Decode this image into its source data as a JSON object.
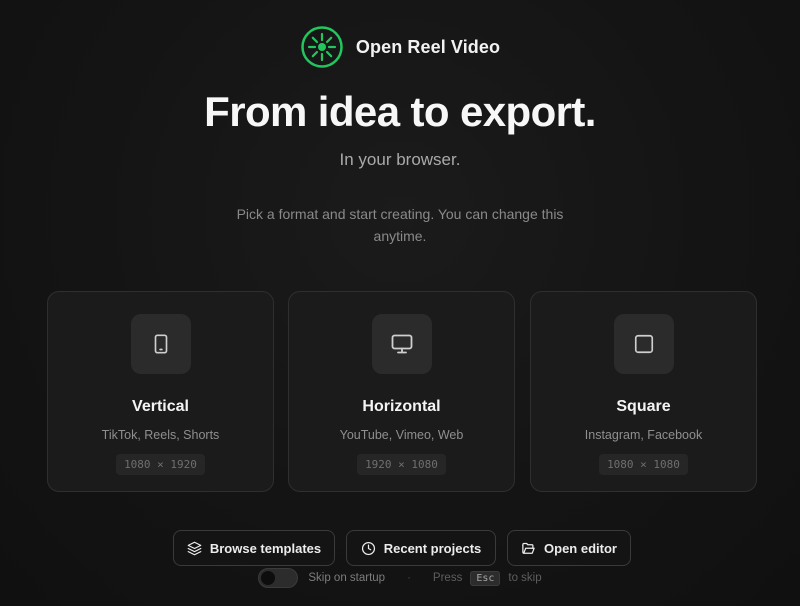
{
  "brand": {
    "name": "Open Reel Video",
    "logo_icon": "aperture-icon",
    "accent": "#22c55e"
  },
  "hero": {
    "headline": "From idea to export.",
    "subheadline": "In your browser.",
    "hint": "Pick a format and start creating. You can change this anytime."
  },
  "formats": [
    {
      "title": "Vertical",
      "platforms": "TikTok, Reels, Shorts",
      "resolution": "1080 × 1920",
      "icon": "phone-icon"
    },
    {
      "title": "Horizontal",
      "platforms": "YouTube, Vimeo, Web",
      "resolution": "1920 × 1080",
      "icon": "monitor-icon"
    },
    {
      "title": "Square",
      "platforms": "Instagram, Facebook",
      "resolution": "1080 × 1080",
      "icon": "square-icon"
    }
  ],
  "actions": {
    "browse_templates": "Browse templates",
    "recent_projects": "Recent projects",
    "open_editor": "Open editor"
  },
  "footer": {
    "skip_label": "Skip on startup",
    "separator": "·",
    "press_label": "Press",
    "key": "Esc",
    "skip_suffix": "to skip",
    "skip_enabled": false
  }
}
